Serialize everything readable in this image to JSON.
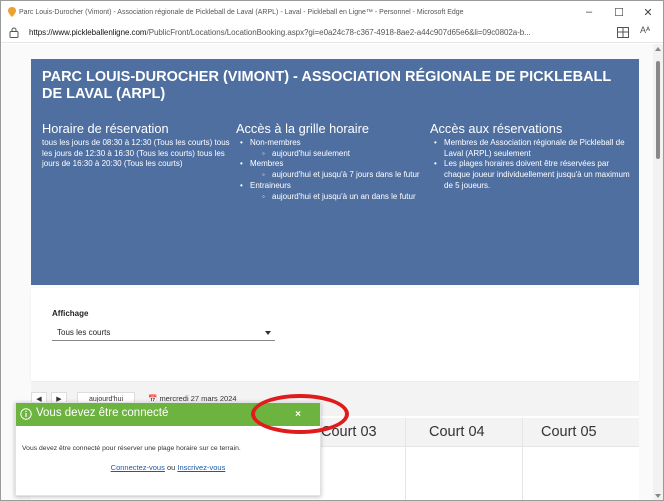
{
  "window": {
    "title": "Parc Louis-Durocher (Vimont) - Association régionale de Pickleball de Laval (ARPL) - Laval - Pickleball en Ligne™ - Personnel - Microsoft Edge",
    "minimize": "–",
    "maximize": "☐",
    "close": "✕"
  },
  "address_bar": {
    "url_host": "https://www.pickleballenligne.com",
    "url_path": "/PublicFront/Locations/LocationBooking.aspx?gi=e0a24c78-c367-4918-8ae2-a44c907d65e6&li=09c0802a-b..."
  },
  "banner": {
    "title": "PARC LOUIS-DUROCHER (VIMONT) - ASSOCIATION RÉGIONALE DE PICKLEBALL DE LAVAL (ARPL)",
    "schedule": {
      "heading": "Horaire de réservation",
      "text": "tous les jours de 08:30 à 12:30 (Tous les courts) tous les jours de 12:30 à 16:30 (Tous les courts) tous les jours de 16:30 à 20:30 (Tous les courts)"
    },
    "grid_access": {
      "heading": "Accès à la grille horaire",
      "groups": [
        {
          "label": "Non-membres",
          "sub": "aujourd'hui seulement"
        },
        {
          "label": "Membres",
          "sub": "aujourd'hui et jusqu'à 7 jours dans le futur"
        },
        {
          "label": "Entraineurs",
          "sub": "aujourd'hui et jusqu'à un an dans le futur"
        }
      ]
    },
    "reservation_access": {
      "heading": "Accès aux réservations",
      "items": [
        "Membres de Association régionale de Pickleball de Laval (ARPL) seulement",
        "Les plages horaires doivent être réservées par chaque joueur individuellement jusqu'à un maximum de 5 joueurs."
      ]
    }
  },
  "display_filter": {
    "label": "Affichage",
    "selected": "Tous les courts"
  },
  "schedule": {
    "prev": "◀",
    "next": "▶",
    "today": "aujourd'hui",
    "date": "mercredi 27 mars 2024",
    "courts": [
      "Court 03",
      "Court 04",
      "Court 05"
    ]
  },
  "toast": {
    "title": "Vous devez être connecté",
    "close": "×",
    "message": "Vous devez être connecté pour réserver une plage horaire sur ce terrain.",
    "login": "Connectez-vous",
    "or": "ou",
    "register": "Inscrivez-vous"
  },
  "colors": {
    "banner": "#4f6fa0",
    "toast_header": "#6cb33f",
    "annotation_circle": "#e01b1b",
    "link": "#1a5ba8"
  }
}
